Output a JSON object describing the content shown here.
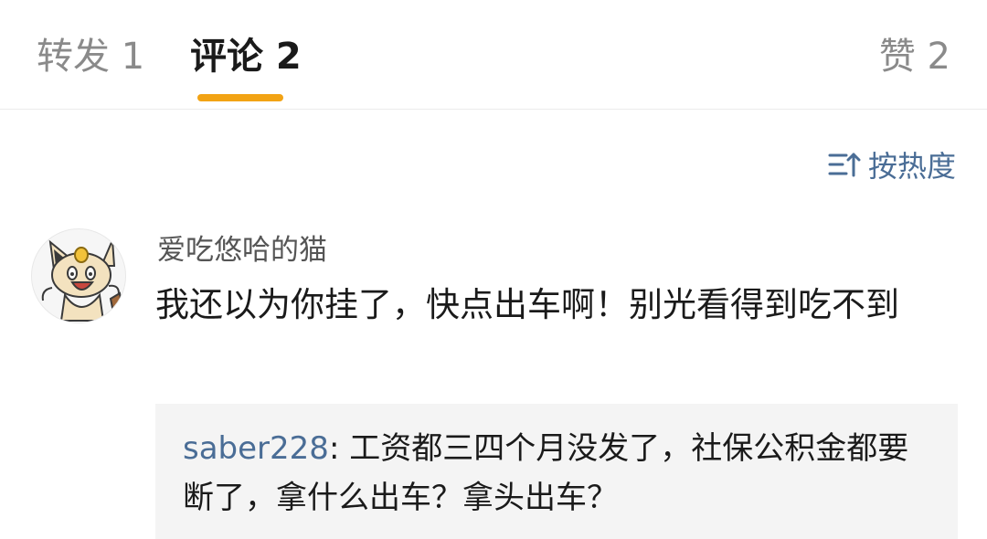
{
  "tabs": {
    "repost": "转发 1",
    "comments": "评论 2",
    "likes": "赞 2"
  },
  "sort": {
    "label": "按热度"
  },
  "comment": {
    "author": "爱吃悠哈的猫",
    "text": "我还以为你挂了，快点出车啊！别光看得到吃不到",
    "reply": {
      "user": "saber228",
      "separator": ": ",
      "text": "工资都三四个月没发了，社保公积金都要断了，拿什么出车？拿头出车？"
    }
  },
  "colors": {
    "accent": "#f2a314",
    "link": "#4a6d96",
    "text": "#1a1a1a",
    "muted": "#8a8a8a",
    "reply_bg": "#f4f4f4"
  }
}
